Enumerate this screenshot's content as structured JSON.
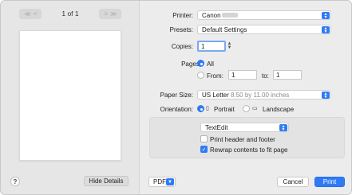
{
  "preview": {
    "first_btn": "≪",
    "prev_btn": "<",
    "next_btn": ">",
    "last_btn": "≫",
    "page_count": "1 of 1",
    "help_label": "?",
    "hide_details_label": "Hide Details"
  },
  "printer": {
    "label": "Printer:",
    "value": "Canon"
  },
  "presets": {
    "label": "Presets:",
    "value": "Default Settings"
  },
  "copies": {
    "label": "Copies:",
    "value": "1"
  },
  "pages": {
    "label": "Pages:",
    "all_label": "All",
    "from_label": "From:",
    "from_value": "1",
    "to_label": "to:",
    "to_value": "1"
  },
  "paper_size": {
    "label": "Paper Size:",
    "value": "US Letter",
    "detail": "8.50 by 11.00 inches"
  },
  "orientation": {
    "label": "Orientation:",
    "portrait_label": "Portrait",
    "landscape_label": "Landscape"
  },
  "app_section": {
    "popup_value": "TextEdit",
    "header_footer_label": "Print header and footer",
    "rewrap_label": "Rewrap contents to fit page"
  },
  "footer": {
    "pdf_label": "PDF",
    "cancel_label": "Cancel",
    "print_label": "Print"
  },
  "colors": {
    "accent": "#2f7bf5",
    "panel": "#ececec",
    "preview_pane": "#e6e6e6"
  }
}
